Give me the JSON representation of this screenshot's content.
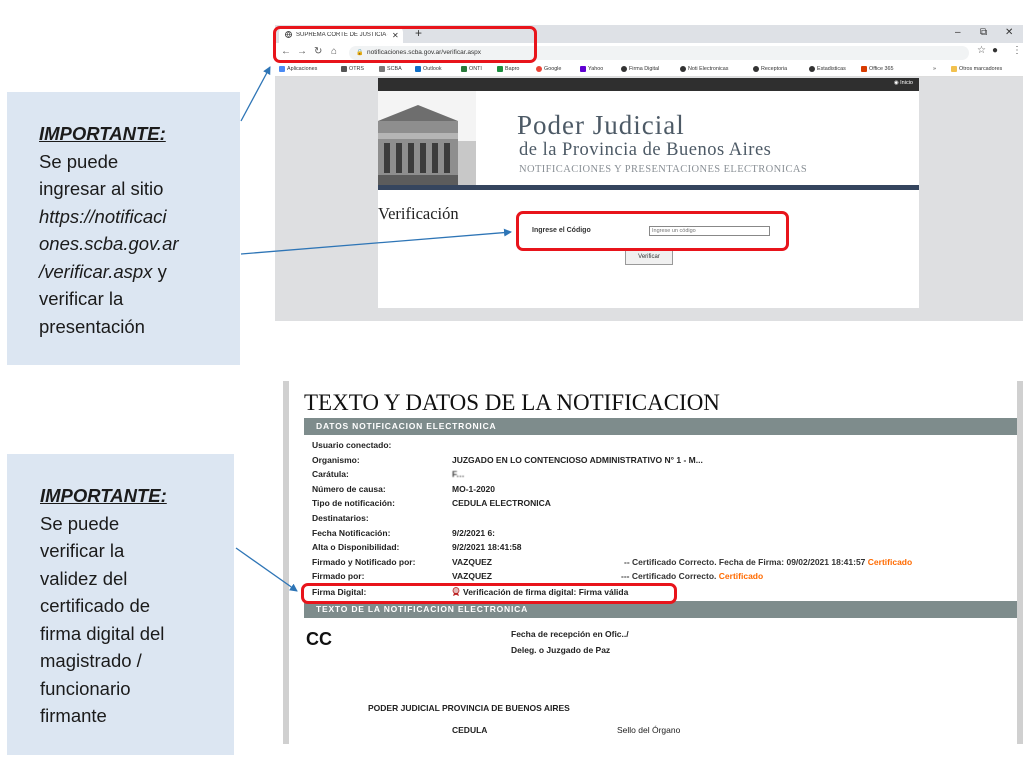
{
  "callout1": {
    "heading": "IMPORTANTE:",
    "line1": "Se puede",
    "line2": "ingresar al sitio",
    "line3": "https://notificaci",
    "line4": "ones.scba.gov.ar",
    "line5_italic": "/verificar.aspx",
    "line5_rest": " y",
    "line6": "verificar la",
    "line7": "presentación"
  },
  "callout2": {
    "heading": "IMPORTANTE:",
    "lines": [
      "Se puede",
      "verificar la",
      "validez del",
      "certificado de",
      "firma digital del",
      "magistrado /",
      "funcionario",
      "firmante"
    ]
  },
  "browser": {
    "tab_title": "SUPREMA CORTE DE JUSTICIA - N",
    "url": "notificaciones.scba.gov.ar/verificar.aspx",
    "bookmarks": [
      "Aplicaciones",
      "OTRS",
      "SCBA",
      "Outlook",
      "ONTI",
      "Bapro",
      "Google",
      "Yahoo",
      "Firma Digital",
      "Noti Electronicas",
      "Receptoria",
      "Estadisticas",
      "Office 365"
    ],
    "other_bookmarks": "Otros marcadores",
    "more": "»"
  },
  "site": {
    "inicio": "Inicio",
    "title": "Poder Judicial",
    "subtitle": "de la Provincia de Buenos Aires",
    "subtitle2": "NOTIFICACIONES Y PRESENTACIONES ELECTRONICAS",
    "section": "Verificación",
    "code_label": "Ingrese el Código",
    "code_placeholder": "Ingrese un código",
    "verify_button": "Verificar"
  },
  "notification": {
    "title": "TEXTO Y DATOS DE LA NOTIFICACION",
    "section1": "DATOS NOTIFICACION ELECTRONICA",
    "fields": [
      {
        "label": "Usuario conectado:",
        "value": ""
      },
      {
        "label": "Organismo:",
        "value": "JUZGADO EN LO CONTENCIOSO ADMINISTRATIVO N° 1 - M..."
      },
      {
        "label": "Carátula:",
        "value": "F..."
      },
      {
        "label": "Número de causa:",
        "value": "MO-1-2020"
      },
      {
        "label": "Tipo de notificación:",
        "value": "CEDULA ELECTRONICA"
      },
      {
        "label": "Destinatarios:",
        "value": ""
      },
      {
        "label": "Fecha Notificación:",
        "value": "9/2/2021 6:"
      },
      {
        "label": "Alta o Disponibilidad:",
        "value": "9/2/2021 18:41:58"
      },
      {
        "label": "Firmado y Notificado por:",
        "value": "VAZQUEZ"
      },
      {
        "label": "Firmado por:",
        "value": "VAZQUEZ"
      },
      {
        "label": "Firma Digital:",
        "value": "Verificación de firma digital: Firma válida"
      }
    ],
    "cert1_text": "-- Certificado Correcto. Fecha de Firma: 09/02/2021 18:41:57",
    "cert1_link": "Certificado",
    "cert2_text": "--- Certificado Correcto.",
    "cert2_link": "Certificado",
    "section2": "TEXTO DE LA NOTIFICACION ELECTRONICA",
    "cc": "CC",
    "recepcion": "Fecha de recepción en Ofic../",
    "deleg": "Deleg. o Juzgado de Paz",
    "poder": "PODER JUDICIAL PROVINCIA DE BUENOS AIRES",
    "cedula": "CEDULA",
    "sello": "Sello del Órgano"
  },
  "colors": {
    "highlight": "#e8141b",
    "arrow": "#2e75b6",
    "callout_bg": "#dce6f2",
    "section_bar": "#7e8c8c",
    "certificado_link": "#ff6a00"
  }
}
